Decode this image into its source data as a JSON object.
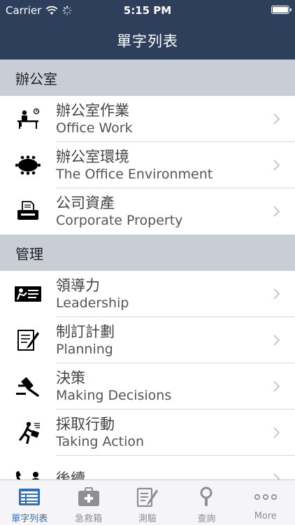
{
  "status": {
    "carrier": "Carrier",
    "time": "5:15 PM"
  },
  "nav": {
    "title": "單字列表"
  },
  "sections": [
    {
      "title": "辦公室",
      "rows": [
        {
          "zh": "辦公室作業",
          "en": "Office Work",
          "icon": "office-desk-icon"
        },
        {
          "zh": "辦公室環境",
          "en": "The Office Environment",
          "icon": "meeting-table-icon"
        },
        {
          "zh": "公司資產",
          "en": "Corporate Property",
          "icon": "printer-icon"
        }
      ]
    },
    {
      "title": "管理",
      "rows": [
        {
          "zh": "領導力",
          "en": "Leadership",
          "icon": "presentation-icon"
        },
        {
          "zh": "制訂計劃",
          "en": "Planning",
          "icon": "document-pen-icon"
        },
        {
          "zh": "決策",
          "en": "Making Decisions",
          "icon": "gavel-icon"
        },
        {
          "zh": "採取行動",
          "en": "Taking Action",
          "icon": "running-person-icon"
        },
        {
          "zh": "後續",
          "en": "",
          "icon": "phone-person-icon"
        }
      ]
    }
  ],
  "tabs": [
    {
      "label": "單字列表",
      "icon": "list-icon",
      "active": true
    },
    {
      "label": "急救箱",
      "icon": "first-aid-kit-icon",
      "active": false
    },
    {
      "label": "測驗",
      "icon": "quiz-pencil-icon",
      "active": false
    },
    {
      "label": "查詢",
      "icon": "search-icon",
      "active": false
    },
    {
      "label": "More",
      "icon": "more-dots-icon",
      "active": false
    }
  ],
  "colors": {
    "nav": "#2e3f5c",
    "section": "#c8cdd6",
    "tab_active": "#2f6fc2",
    "tab_inactive": "#8e8e93"
  }
}
